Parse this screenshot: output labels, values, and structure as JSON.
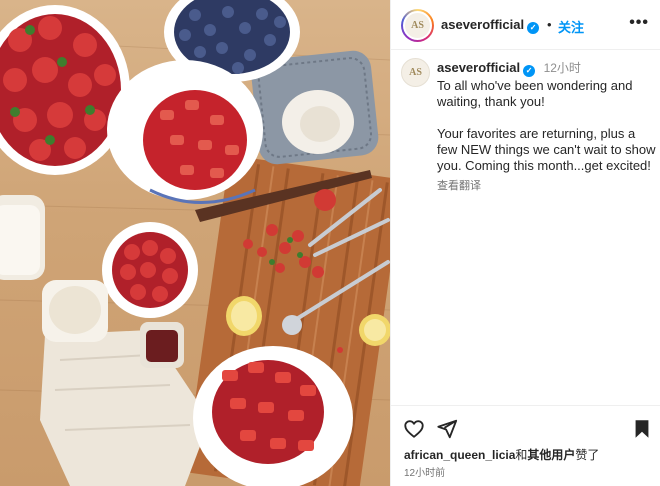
{
  "post": {
    "username": "aseverofficial",
    "separator": "•",
    "follow_label": "关注",
    "more_label": "•••",
    "avatar_initials": "AS",
    "icons": {
      "verified": "verified-badge-icon",
      "more": "more-options-icon",
      "like": "heart-icon",
      "share": "paper-plane-icon",
      "save": "bookmark-icon"
    }
  },
  "caption": {
    "username": "aseverofficial",
    "time": "12小时",
    "paragraphs": [
      "To all who've been wondering and waiting, thank you!",
      "Your favorites are returning, plus a few NEW things we can't wait to show you. Coming this month...get excited!"
    ],
    "translate_label": "查看翻译"
  },
  "footer": {
    "liked_user": "african_queen_licia",
    "liked_join": "和",
    "liked_others": "其他用户",
    "liked_suffix": "赞了",
    "timestamp": "12小时前"
  },
  "colors": {
    "accent_blue": "#0095f6",
    "text_primary": "#262626",
    "text_secondary": "#8e8e8e",
    "table_wood": "#cfa476",
    "strawberry_red": "#c8232c",
    "blueberry_blue": "#3a4a78"
  }
}
